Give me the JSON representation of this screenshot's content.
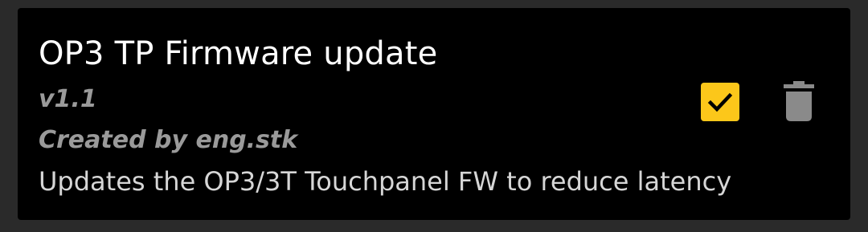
{
  "module": {
    "title": "OP3 TP Firmware update",
    "version": "v1.1",
    "author": "Created by eng.stk",
    "description": "Updates the OP3/3T Touchpanel FW to reduce latency",
    "enabled": true
  },
  "icons": {
    "checkbox": "check-icon",
    "delete": "trash-icon"
  },
  "colors": {
    "accent": "#fcc71a",
    "card_background": "#000000",
    "page_background": "#2a2a2a",
    "title": "#ffffff",
    "meta_text": "#9a9a9a",
    "description_text": "#d6d6d6",
    "icon_gray": "#8a8a8a"
  }
}
